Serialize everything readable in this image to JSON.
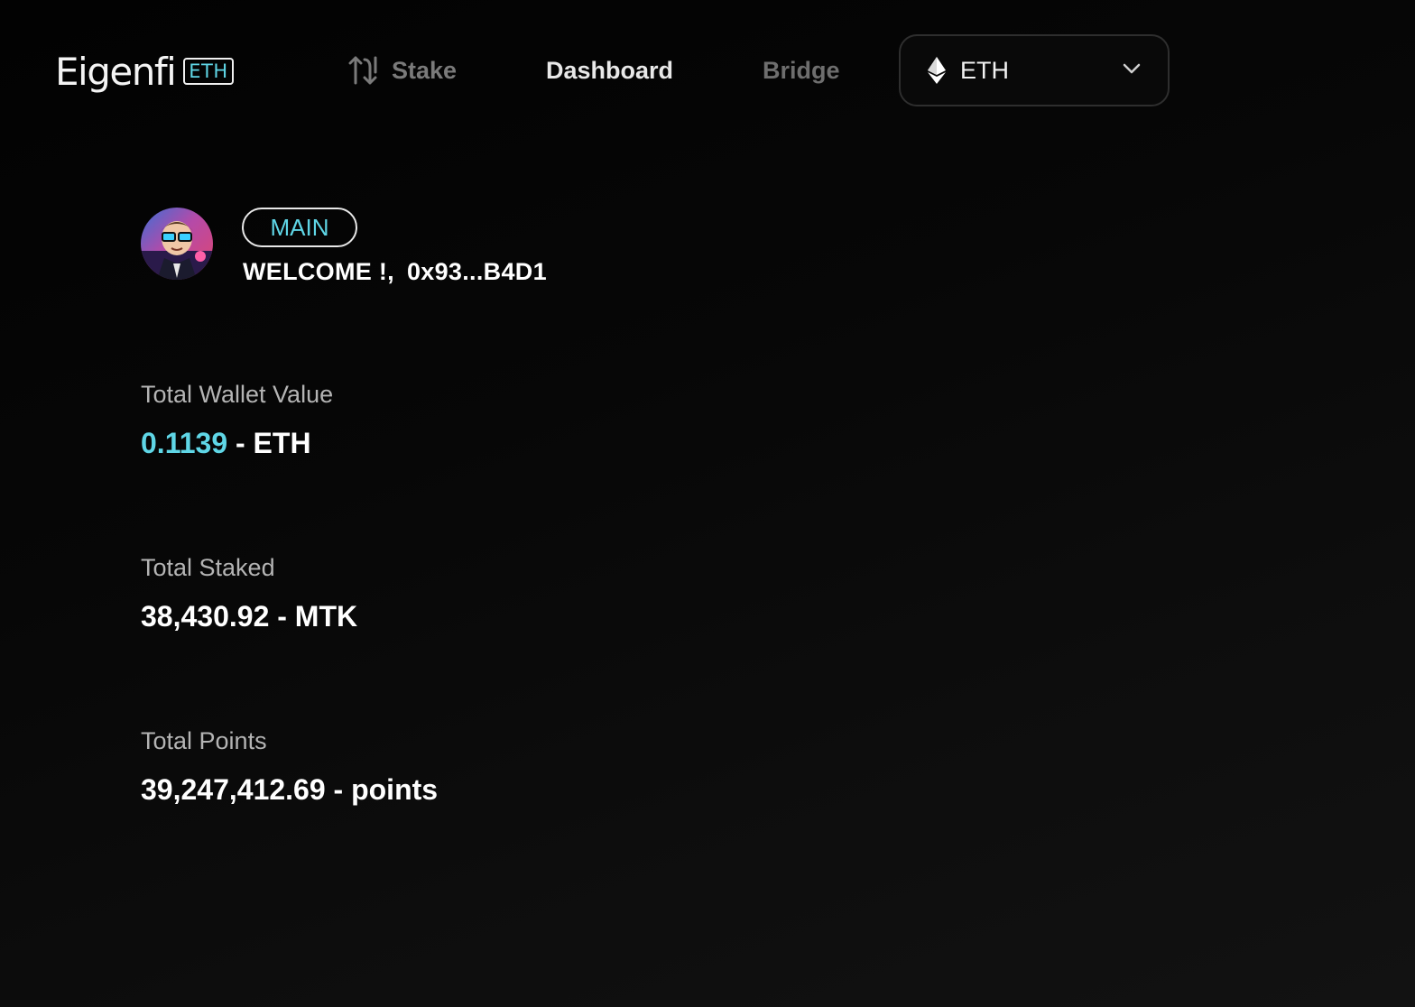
{
  "header": {
    "logo_text": "Eigenfi",
    "logo_badge": "ETH",
    "nav": {
      "stake": "Stake",
      "dashboard": "Dashboard",
      "bridge": "Bridge"
    },
    "chain_select": {
      "label": "ETH",
      "icon": "ethereum-icon"
    }
  },
  "profile": {
    "badge": "MAIN",
    "welcome": "WELCOME !,",
    "address": "0x93...B4D1"
  },
  "stats": {
    "wallet": {
      "label": "Total Wallet Value",
      "amount": "0.1139",
      "unit": " - ETH"
    },
    "staked": {
      "label": "Total Staked",
      "value": "38,430.92 - MTK"
    },
    "points": {
      "label": "Total Points",
      "value": "39,247,412.69 - points"
    }
  },
  "colors": {
    "accent": "#5fd6e6",
    "background": "#050505"
  }
}
